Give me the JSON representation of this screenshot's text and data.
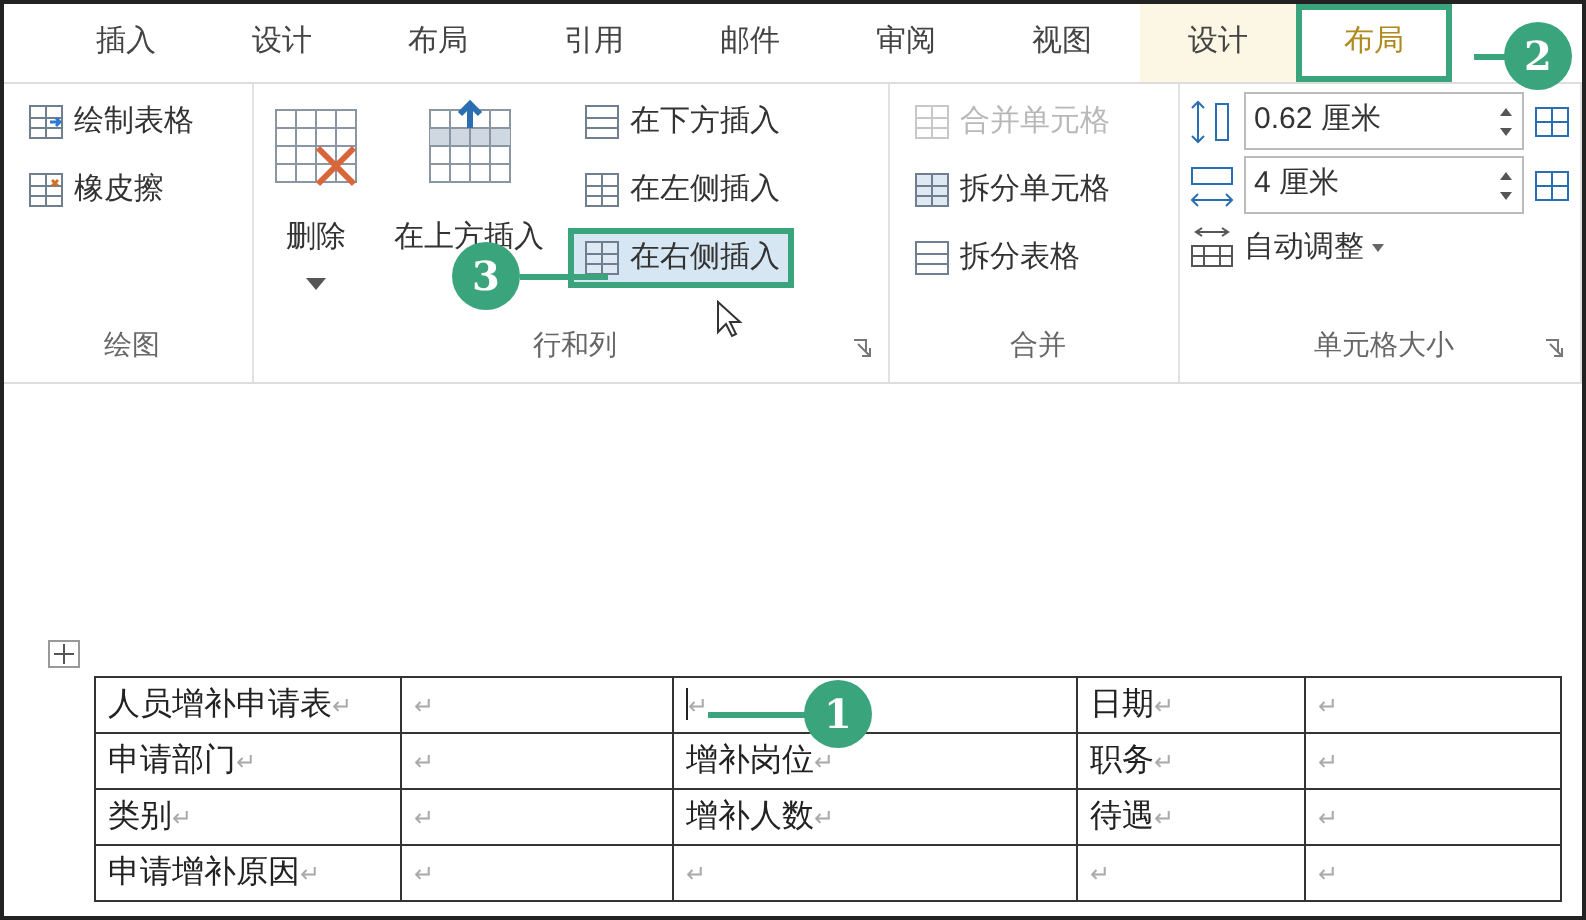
{
  "tabs": [
    {
      "label": "插入",
      "selected": false,
      "contextual": false
    },
    {
      "label": "设计",
      "selected": false,
      "contextual": false
    },
    {
      "label": "布局",
      "selected": false,
      "contextual": false
    },
    {
      "label": "引用",
      "selected": false,
      "contextual": false
    },
    {
      "label": "邮件",
      "selected": false,
      "contextual": false
    },
    {
      "label": "审阅",
      "selected": false,
      "contextual": false
    },
    {
      "label": "视图",
      "selected": false,
      "contextual": false
    },
    {
      "label": "设计",
      "selected": false,
      "contextual": true
    },
    {
      "label": "布局",
      "selected": true,
      "contextual": true
    }
  ],
  "groups": [
    {
      "label": "绘图",
      "launcher": false,
      "items": [
        {
          "kind": "small",
          "label": "绘制表格",
          "disabled": false,
          "highlighted": false
        },
        {
          "kind": "small",
          "label": "橡皮擦",
          "disabled": false,
          "highlighted": false
        }
      ]
    },
    {
      "label": "行和列",
      "launcher": true,
      "items": [
        {
          "kind": "large-dropdown",
          "label": "删除"
        },
        {
          "kind": "large",
          "label": "在上方插入"
        },
        {
          "kind": "small",
          "label": "在下方插入",
          "disabled": false,
          "highlighted": false
        },
        {
          "kind": "small",
          "label": "在左侧插入",
          "disabled": false,
          "highlighted": false
        },
        {
          "kind": "small",
          "label": "在右侧插入",
          "disabled": false,
          "highlighted": true
        }
      ]
    },
    {
      "label": "合并",
      "launcher": false,
      "items": [
        {
          "kind": "small",
          "label": "合并单元格",
          "disabled": true,
          "highlighted": false
        },
        {
          "kind": "small",
          "label": "拆分单元格",
          "disabled": false,
          "highlighted": false
        },
        {
          "kind": "small",
          "label": "拆分表格",
          "disabled": false,
          "highlighted": false
        }
      ]
    },
    {
      "label": "单元格大小",
      "launcher": true,
      "items": [
        {
          "kind": "spin",
          "value": "0.62 厘米"
        },
        {
          "kind": "spin",
          "value": "4 厘米"
        },
        {
          "kind": "dropdown",
          "label": "自动调整"
        }
      ]
    }
  ],
  "table": {
    "rows": [
      [
        {
          "text": "人员增补申请表",
          "mark": "↵"
        },
        {
          "text": "",
          "mark": "↵"
        },
        {
          "text": "",
          "mark": "↵",
          "cursor": true
        },
        {
          "text": "日期",
          "mark": "↵"
        },
        {
          "text": "",
          "mark": "↵"
        }
      ],
      [
        {
          "text": "申请部门",
          "mark": "↵"
        },
        {
          "text": "",
          "mark": "↵"
        },
        {
          "text": "增补岗位",
          "mark": "↵"
        },
        {
          "text": "职务",
          "mark": "↵"
        },
        {
          "text": "",
          "mark": "↵"
        }
      ],
      [
        {
          "text": "类别",
          "mark": "↵"
        },
        {
          "text": "",
          "mark": "↵"
        },
        {
          "text": "增补人数",
          "mark": "↵"
        },
        {
          "text": "待遇",
          "mark": "↵"
        },
        {
          "text": "",
          "mark": "↵"
        }
      ],
      [
        {
          "text": "申请增补原因",
          "mark": "↵"
        },
        {
          "text": "",
          "mark": "↵"
        },
        {
          "text": "",
          "mark": "↵"
        },
        {
          "text": "",
          "mark": "↵"
        },
        {
          "text": "",
          "mark": "↵"
        }
      ]
    ]
  },
  "callouts": [
    {
      "number": "1"
    },
    {
      "number": "2"
    },
    {
      "number": "3"
    }
  ]
}
